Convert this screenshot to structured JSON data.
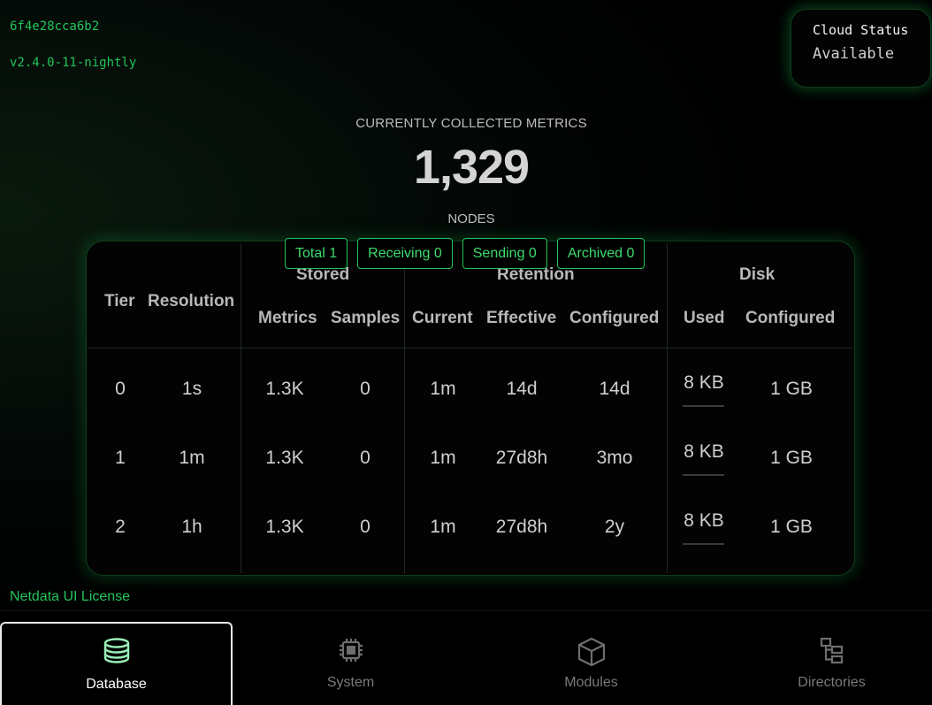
{
  "header": {
    "build_hash": "6f4e28cca6b2",
    "version": "v2.4.0-11-nightly"
  },
  "cloud": {
    "title": "Cloud Status",
    "value": "Available"
  },
  "metrics": {
    "caption": "CURRENTLY COLLECTED METRICS",
    "value": "1,329",
    "nodes_caption": "NODES"
  },
  "nodes": {
    "total": "Total 1",
    "receiving": "Receiving 0",
    "sending": "Sending 0",
    "archived": "Archived 0"
  },
  "table": {
    "headers": {
      "tier": "Tier",
      "resolution": "Resolution",
      "stored": "Stored",
      "retention": "Retention",
      "disk": "Disk",
      "metrics": "Metrics",
      "samples": "Samples",
      "current": "Current",
      "effective": "Effective",
      "configured": "Configured",
      "used": "Used",
      "disk_configured": "Configured"
    },
    "rows": [
      {
        "tier": "0",
        "resolution": "1s",
        "metrics": "1.3K",
        "samples": "0",
        "current": "1m",
        "effective": "14d",
        "configured": "14d",
        "used": "8 KB",
        "disk_configured": "1 GB"
      },
      {
        "tier": "1",
        "resolution": "1m",
        "metrics": "1.3K",
        "samples": "0",
        "current": "1m",
        "effective": "27d8h",
        "configured": "3mo",
        "used": "8 KB",
        "disk_configured": "1 GB"
      },
      {
        "tier": "2",
        "resolution": "1h",
        "metrics": "1.3K",
        "samples": "0",
        "current": "1m",
        "effective": "27d8h",
        "configured": "2y",
        "used": "8 KB",
        "disk_configured": "1 GB"
      }
    ]
  },
  "footer": {
    "license": "Netdata UI License"
  },
  "nav": {
    "items": [
      {
        "label": "Database",
        "icon": "database-icon",
        "active": true
      },
      {
        "label": "System",
        "icon": "chip-icon",
        "active": false
      },
      {
        "label": "Modules",
        "icon": "cube-icon",
        "active": false
      },
      {
        "label": "Directories",
        "icon": "folder-tree-icon",
        "active": false
      }
    ]
  },
  "colors": {
    "accent": "#23c45a",
    "background": "#000000",
    "text": "#cfcfcf"
  }
}
